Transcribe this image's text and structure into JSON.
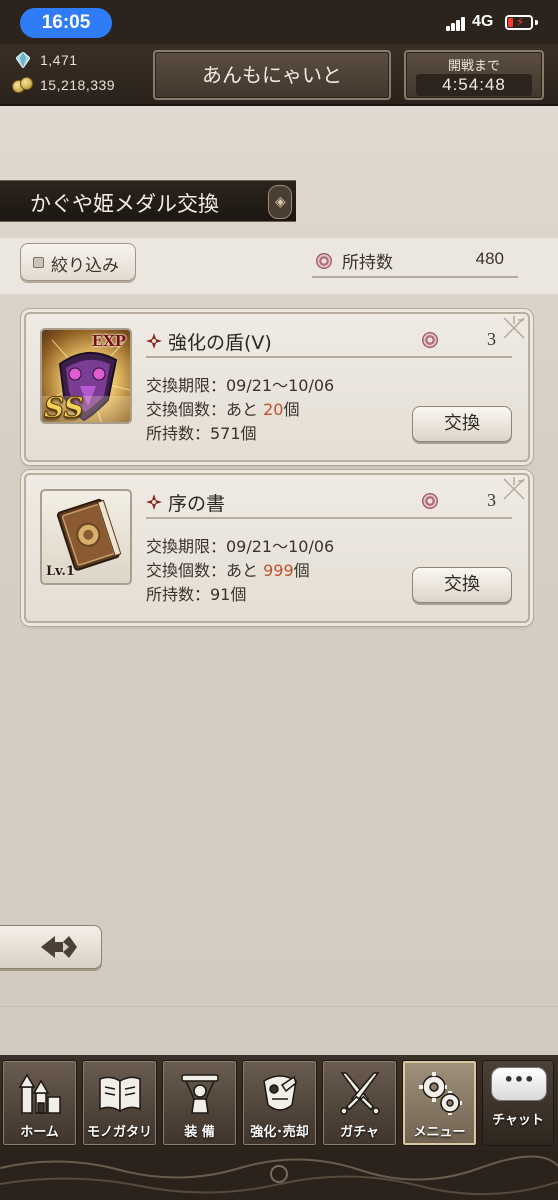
{
  "status_bar": {
    "time": "16:05",
    "network": "4G",
    "battery_level": 0.15,
    "battery_color": "#ff3b30"
  },
  "header": {
    "gems": "1,471",
    "coins": "15,218,339",
    "player_name": "あんもにゃいと",
    "battle_label": "開戦まで",
    "battle_countdown": "4:54:48"
  },
  "page": {
    "title": "かぐや姫メダル交換",
    "filter_label": "絞り込み",
    "owned_label": "所持数",
    "owned_value": "480"
  },
  "items": [
    {
      "name": "強化の盾(Ⅴ)",
      "cost": "3",
      "badge_top": "EXP",
      "badge_bottom": "SS",
      "period": "交換期限：09/21〜10/06",
      "remaining_prefix": "交換個数：あと ",
      "remaining_value": "20",
      "remaining_suffix": "個",
      "owned": "所持数：571個",
      "button": "交換"
    },
    {
      "name": "序の書",
      "cost": "3",
      "badge_bottom": "Lv.1",
      "period": "交換期限：09/21〜10/06",
      "remaining_prefix": "交換個数：あと ",
      "remaining_value": "999",
      "remaining_suffix": "個",
      "owned": "所持数：91個",
      "button": "交換"
    }
  ],
  "nav": {
    "items": [
      {
        "label": "ホーム",
        "icon": "castle-icon"
      },
      {
        "label": "モノガタリ",
        "icon": "book-icon"
      },
      {
        "label": "装 備",
        "icon": "equipment-icon"
      },
      {
        "label": "強化･売却",
        "icon": "armor-icon"
      },
      {
        "label": "ガチャ",
        "icon": "crossed-swords-icon"
      },
      {
        "label": "メニュー",
        "icon": "gears-icon",
        "active": true
      }
    ],
    "chat_bubble": "•••",
    "chat_label": "チャット"
  },
  "colors": {
    "highlight": "#c0522b",
    "time_pill": "#2f7cf6"
  }
}
